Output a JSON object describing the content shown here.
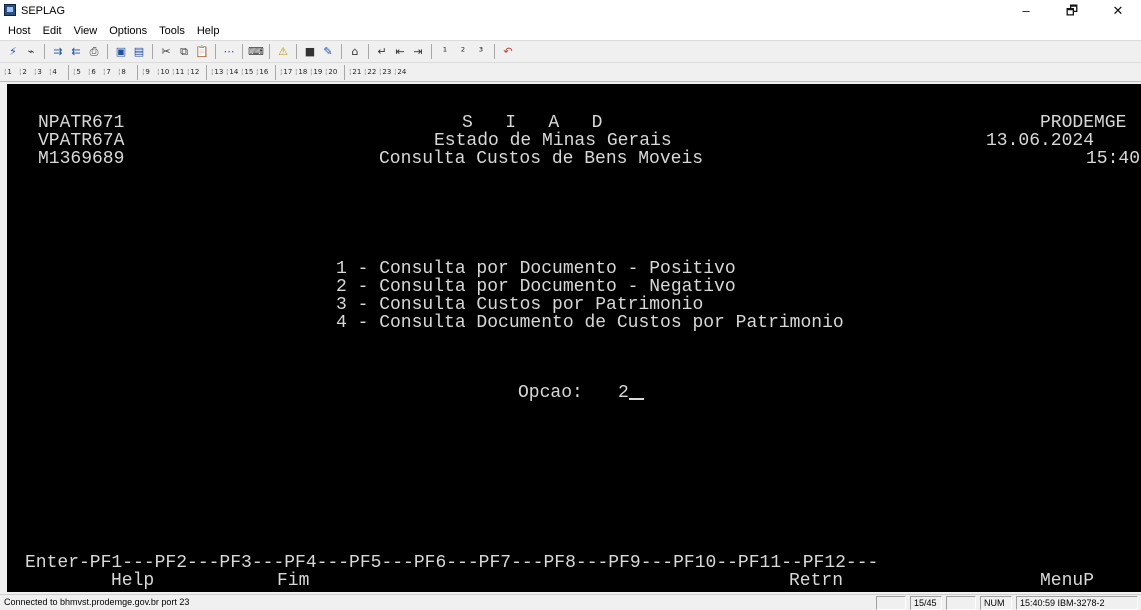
{
  "window": {
    "title": "SEPLAG",
    "controls": {
      "minimize": "–",
      "maximize": "🗗",
      "close": "✕"
    }
  },
  "menu": [
    "Host",
    "Edit",
    "View",
    "Options",
    "Tools",
    "Help"
  ],
  "toolbar": {
    "icons": [
      "connect-icon",
      "disconnect-icon",
      "send-icon",
      "receive-icon",
      "print-icon",
      "copy-screen-icon",
      "paste-screen-icon",
      "cut-icon",
      "copy-icon",
      "paste-icon",
      "macro-icon",
      "keyboard-icon",
      "alert-icon",
      "display-icon",
      "settings-icon",
      "home-icon",
      "enter-icon",
      "backtab-icon",
      "tab-icon",
      "pa1-icon",
      "pa2-icon",
      "pa3-icon",
      "undo-icon"
    ]
  },
  "pf_keys": [
    "1",
    "2",
    "3",
    "4",
    "5",
    "6",
    "7",
    "8",
    "9",
    "10",
    "11",
    "12",
    "13",
    "14",
    "15",
    "16",
    "17",
    "18",
    "19",
    "20",
    "21",
    "22",
    "23",
    "24"
  ],
  "screen": {
    "header": {
      "program": "NPATR671",
      "map": "VPATR67A",
      "user": "M1369689",
      "system": "S   I   A   D",
      "state": "Estado de Minas Gerais",
      "screen_title": "Consulta Custos de Bens Moveis",
      "company": "PRODEMGE",
      "date": "13.06.2024",
      "time": "15:40"
    },
    "options": [
      "1 - Consulta por Documento - Positivo",
      "2 - Consulta por Documento - Negativo",
      "3 - Consulta Custos por Patrimonio",
      "4 - Consulta Documento de Custos por Patrimonio"
    ],
    "option_label": "Opcao:",
    "option_value": "2",
    "function_keys_line": "Enter-PF1---PF2---PF3---PF4---PF5---PF6---PF7---PF8---PF9---PF10--PF11--PF12---",
    "function_key_labels": {
      "pf1": "Help",
      "pf3": "Fim",
      "pf9": "Retrn",
      "pf12": "MenuP"
    }
  },
  "status": {
    "connection": "Connected to bhmvst.prodemge.gov.br port 23",
    "cursor_position": "15/45",
    "num_lock": "NUM",
    "clock_and_model": "15:40:59 IBM-3278-2"
  }
}
